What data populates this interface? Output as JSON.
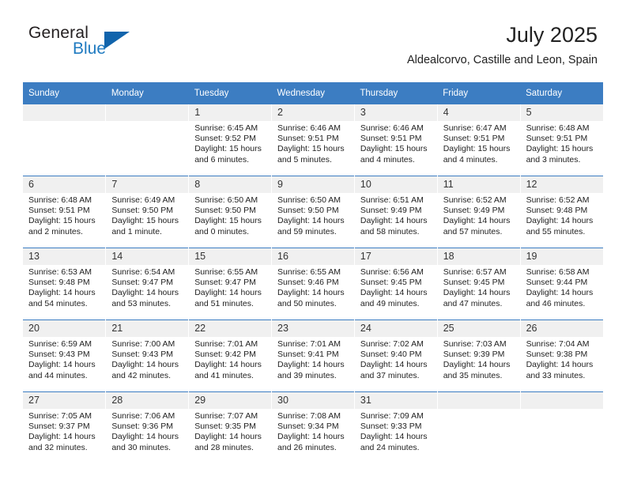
{
  "brand": {
    "name_part1": "General",
    "name_part2": "Blue",
    "colors": {
      "header_blue": "#3c7dc2",
      "logo_blue": "#1f7ac0",
      "triangle_blue": "#1164ac",
      "daynum_band": "#f0f0f0"
    }
  },
  "header": {
    "title": "July 2025",
    "subtitle": "Aldealcorvo, Castille and Leon, Spain"
  },
  "calendar": {
    "weekday_headers": [
      "Sunday",
      "Monday",
      "Tuesday",
      "Wednesday",
      "Thursday",
      "Friday",
      "Saturday"
    ],
    "labels": {
      "sunrise": "Sunrise:",
      "sunset": "Sunset:",
      "daylight": "Daylight:"
    },
    "weeks": [
      [
        {
          "day": ""
        },
        {
          "day": ""
        },
        {
          "day": "1",
          "sunrise": "Sunrise: 6:45 AM",
          "sunset": "Sunset: 9:52 PM",
          "daylight": "Daylight: 15 hours and 6 minutes."
        },
        {
          "day": "2",
          "sunrise": "Sunrise: 6:46 AM",
          "sunset": "Sunset: 9:51 PM",
          "daylight": "Daylight: 15 hours and 5 minutes."
        },
        {
          "day": "3",
          "sunrise": "Sunrise: 6:46 AM",
          "sunset": "Sunset: 9:51 PM",
          "daylight": "Daylight: 15 hours and 4 minutes."
        },
        {
          "day": "4",
          "sunrise": "Sunrise: 6:47 AM",
          "sunset": "Sunset: 9:51 PM",
          "daylight": "Daylight: 15 hours and 4 minutes."
        },
        {
          "day": "5",
          "sunrise": "Sunrise: 6:48 AM",
          "sunset": "Sunset: 9:51 PM",
          "daylight": "Daylight: 15 hours and 3 minutes."
        }
      ],
      [
        {
          "day": "6",
          "sunrise": "Sunrise: 6:48 AM",
          "sunset": "Sunset: 9:51 PM",
          "daylight": "Daylight: 15 hours and 2 minutes."
        },
        {
          "day": "7",
          "sunrise": "Sunrise: 6:49 AM",
          "sunset": "Sunset: 9:50 PM",
          "daylight": "Daylight: 15 hours and 1 minute."
        },
        {
          "day": "8",
          "sunrise": "Sunrise: 6:50 AM",
          "sunset": "Sunset: 9:50 PM",
          "daylight": "Daylight: 15 hours and 0 minutes."
        },
        {
          "day": "9",
          "sunrise": "Sunrise: 6:50 AM",
          "sunset": "Sunset: 9:50 PM",
          "daylight": "Daylight: 14 hours and 59 minutes."
        },
        {
          "day": "10",
          "sunrise": "Sunrise: 6:51 AM",
          "sunset": "Sunset: 9:49 PM",
          "daylight": "Daylight: 14 hours and 58 minutes."
        },
        {
          "day": "11",
          "sunrise": "Sunrise: 6:52 AM",
          "sunset": "Sunset: 9:49 PM",
          "daylight": "Daylight: 14 hours and 57 minutes."
        },
        {
          "day": "12",
          "sunrise": "Sunrise: 6:52 AM",
          "sunset": "Sunset: 9:48 PM",
          "daylight": "Daylight: 14 hours and 55 minutes."
        }
      ],
      [
        {
          "day": "13",
          "sunrise": "Sunrise: 6:53 AM",
          "sunset": "Sunset: 9:48 PM",
          "daylight": "Daylight: 14 hours and 54 minutes."
        },
        {
          "day": "14",
          "sunrise": "Sunrise: 6:54 AM",
          "sunset": "Sunset: 9:47 PM",
          "daylight": "Daylight: 14 hours and 53 minutes."
        },
        {
          "day": "15",
          "sunrise": "Sunrise: 6:55 AM",
          "sunset": "Sunset: 9:47 PM",
          "daylight": "Daylight: 14 hours and 51 minutes."
        },
        {
          "day": "16",
          "sunrise": "Sunrise: 6:55 AM",
          "sunset": "Sunset: 9:46 PM",
          "daylight": "Daylight: 14 hours and 50 minutes."
        },
        {
          "day": "17",
          "sunrise": "Sunrise: 6:56 AM",
          "sunset": "Sunset: 9:45 PM",
          "daylight": "Daylight: 14 hours and 49 minutes."
        },
        {
          "day": "18",
          "sunrise": "Sunrise: 6:57 AM",
          "sunset": "Sunset: 9:45 PM",
          "daylight": "Daylight: 14 hours and 47 minutes."
        },
        {
          "day": "19",
          "sunrise": "Sunrise: 6:58 AM",
          "sunset": "Sunset: 9:44 PM",
          "daylight": "Daylight: 14 hours and 46 minutes."
        }
      ],
      [
        {
          "day": "20",
          "sunrise": "Sunrise: 6:59 AM",
          "sunset": "Sunset: 9:43 PM",
          "daylight": "Daylight: 14 hours and 44 minutes."
        },
        {
          "day": "21",
          "sunrise": "Sunrise: 7:00 AM",
          "sunset": "Sunset: 9:43 PM",
          "daylight": "Daylight: 14 hours and 42 minutes."
        },
        {
          "day": "22",
          "sunrise": "Sunrise: 7:01 AM",
          "sunset": "Sunset: 9:42 PM",
          "daylight": "Daylight: 14 hours and 41 minutes."
        },
        {
          "day": "23",
          "sunrise": "Sunrise: 7:01 AM",
          "sunset": "Sunset: 9:41 PM",
          "daylight": "Daylight: 14 hours and 39 minutes."
        },
        {
          "day": "24",
          "sunrise": "Sunrise: 7:02 AM",
          "sunset": "Sunset: 9:40 PM",
          "daylight": "Daylight: 14 hours and 37 minutes."
        },
        {
          "day": "25",
          "sunrise": "Sunrise: 7:03 AM",
          "sunset": "Sunset: 9:39 PM",
          "daylight": "Daylight: 14 hours and 35 minutes."
        },
        {
          "day": "26",
          "sunrise": "Sunrise: 7:04 AM",
          "sunset": "Sunset: 9:38 PM",
          "daylight": "Daylight: 14 hours and 33 minutes."
        }
      ],
      [
        {
          "day": "27",
          "sunrise": "Sunrise: 7:05 AM",
          "sunset": "Sunset: 9:37 PM",
          "daylight": "Daylight: 14 hours and 32 minutes."
        },
        {
          "day": "28",
          "sunrise": "Sunrise: 7:06 AM",
          "sunset": "Sunset: 9:36 PM",
          "daylight": "Daylight: 14 hours and 30 minutes."
        },
        {
          "day": "29",
          "sunrise": "Sunrise: 7:07 AM",
          "sunset": "Sunset: 9:35 PM",
          "daylight": "Daylight: 14 hours and 28 minutes."
        },
        {
          "day": "30",
          "sunrise": "Sunrise: 7:08 AM",
          "sunset": "Sunset: 9:34 PM",
          "daylight": "Daylight: 14 hours and 26 minutes."
        },
        {
          "day": "31",
          "sunrise": "Sunrise: 7:09 AM",
          "sunset": "Sunset: 9:33 PM",
          "daylight": "Daylight: 14 hours and 24 minutes."
        },
        {
          "day": ""
        },
        {
          "day": ""
        }
      ]
    ]
  }
}
